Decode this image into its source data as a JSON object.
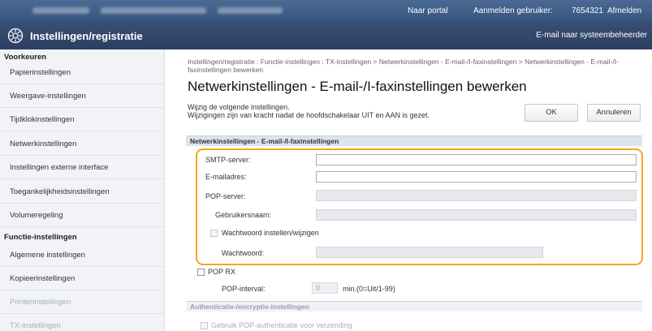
{
  "topbar": {
    "portal": "Naar portal",
    "login_label": "Aanmelden gebruiker:",
    "user_id": "7654321",
    "logout": "Afmelden"
  },
  "header": {
    "title": "Instellingen/registratie",
    "mail_admin": "E-mail naar systeembeheerder"
  },
  "sidebar": {
    "preferences_head": "Voorkeuren",
    "preferences": [
      "Papierinstellingen",
      "Weergave-instellingen",
      "Tijdklokinstellingen",
      "Netwerkinstellingen",
      "Instellingen externe interface",
      "Toegankelijkheidsinstellingen",
      "Volumeregeling"
    ],
    "function_head": "Functie-instellingen",
    "functions": [
      "Algemene instellingen",
      "Kopieerinstellingen",
      "Printerinstellingen",
      "TX-instellingen"
    ]
  },
  "main": {
    "breadcrumb": "Instellingen/registratie : Functie-instellingen : TX-instellingen > Netwerkinstellingen - E-mail-/I-faxinstellingen > Netwerkinstellingen - E-mail-/I-faxinstellingen bewerken",
    "title": "Netwerkinstellingen - E-mail-/I-faxinstellingen bewerken",
    "desc_line1": "Wijzig de volgende instellingen.",
    "desc_line2": "Wijzigingen zijn van kracht nadat de hoofdschakelaar UIT en AAN is gezet.",
    "ok": "OK",
    "cancel": "Annuleren",
    "section1": "Netwerkinstellingen - E-mail-/I-faxinstellingen",
    "smtp_label": "SMTP-server:",
    "smtp_value": "",
    "email_label": "E-mailadres:",
    "email_value": "",
    "pop_label": "POP-server:",
    "username_label": "Gebruikersnaam:",
    "set_password_label": "Wachtwoord instellen/wijzigen",
    "password_label": "Wachtwoord:",
    "pop_rx_label": "POP RX",
    "pop_interval_label": "POP-interval:",
    "pop_interval_value": "0",
    "pop_interval_unit": "min.(0=Uit/1-99)",
    "section2": "Authenticatie-/encryptie-instellingen",
    "pop_auth_label": "Gebruik POP-authenticatie voor verzending"
  },
  "colors": {
    "highlight": "#f5a623",
    "header": "#2b3f62"
  }
}
